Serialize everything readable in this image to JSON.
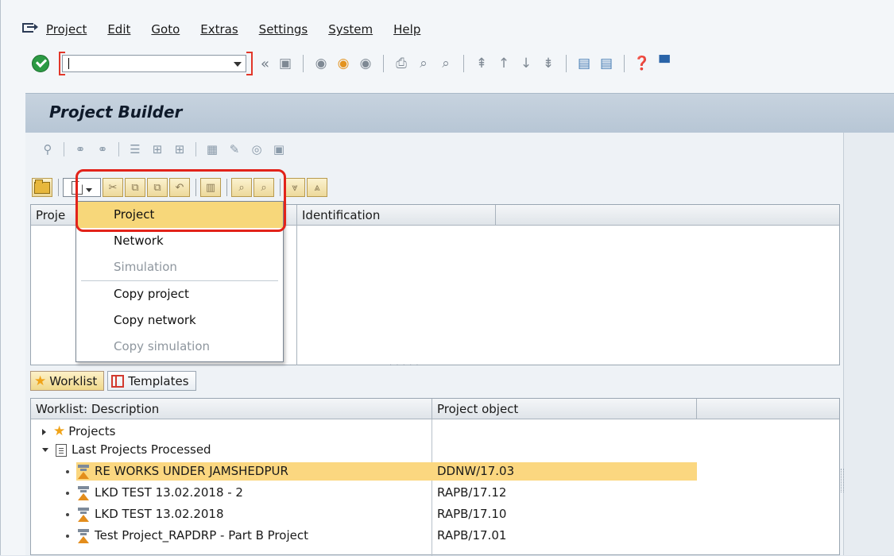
{
  "menubar": {
    "items": [
      {
        "label": "Project"
      },
      {
        "label": "Edit"
      },
      {
        "label": "Goto"
      },
      {
        "label": "Extras"
      },
      {
        "label": "Settings"
      },
      {
        "label": "System"
      },
      {
        "label": "Help"
      }
    ]
  },
  "toolbar": {
    "command_field_value": "",
    "chevron": "«"
  },
  "app": {
    "title": "Project Builder"
  },
  "tree": {
    "col_project": "Proje",
    "col_identification": "Identification"
  },
  "dropdown": {
    "items": [
      {
        "label": "Project",
        "state": "selected"
      },
      {
        "label": "Network",
        "state": "enabled"
      },
      {
        "label": "Simulation",
        "state": "disabled"
      },
      {
        "label": "Copy project",
        "state": "enabled"
      },
      {
        "label": "Copy network",
        "state": "enabled"
      },
      {
        "label": "Copy simulation",
        "state": "disabled"
      }
    ]
  },
  "worklist": {
    "tabs": [
      {
        "label": "Worklist",
        "icon": "star-icon"
      },
      {
        "label": "Templates",
        "icon": "template-icon"
      }
    ],
    "col_description": "Worklist: Description",
    "col_object": "Project object",
    "rows": [
      {
        "description": "Projects",
        "object": ""
      },
      {
        "description": "Last Projects Processed",
        "object": ""
      },
      {
        "description": "RE WORKS UNDER JAMSHEDPUR",
        "object": "DDNW/17.03"
      },
      {
        "description": "LKD TEST 13.02.2018 - 2",
        "object": "RAPB/17.12"
      },
      {
        "description": "LKD TEST 13.02.2018",
        "object": "RAPB/17.10"
      },
      {
        "description": "Test Project_RAPDRP - Part B Project",
        "object": "RAPB/17.01"
      }
    ]
  },
  "colors": {
    "accent_highlight": "#fbd780",
    "menu_selected": "#f7d77a",
    "annotation_red": "#e2231a",
    "ok_green": "#2c9a44"
  }
}
